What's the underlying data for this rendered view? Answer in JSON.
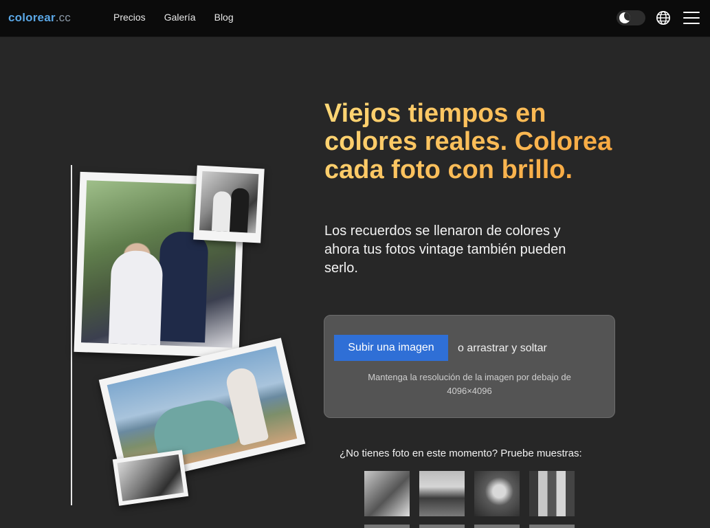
{
  "header": {
    "logo_brand": "colorear",
    "logo_tld": ".cc",
    "nav": [
      "Precios",
      "Galería",
      "Blog"
    ],
    "theme_toggle_icon": "moon-icon",
    "language_icon": "globe-icon",
    "menu_icon": "hamburger-icon"
  },
  "hero": {
    "headline": "Viejos tiempos en colores reales. Colorea cada foto con brillo.",
    "subhead": "Los recuerdos se llenaron de colores y ahora tus fotos vintage también pueden serlo."
  },
  "upload": {
    "button_label": "Subir una imagen",
    "drag_text": "o arrastrar y soltar",
    "note_line1": "Mantenga la resolución de la imagen por debajo de",
    "note_line2": "4096×4096"
  },
  "samples": {
    "title": "¿No tienes foto en este momento? Pruebe muestras:"
  },
  "colors": {
    "header_bg": "#0b0b0b",
    "page_bg": "#272727",
    "accent_blue": "#2f6fd6",
    "headline_gradient": [
      "#ffd978",
      "#f7a33b"
    ]
  }
}
